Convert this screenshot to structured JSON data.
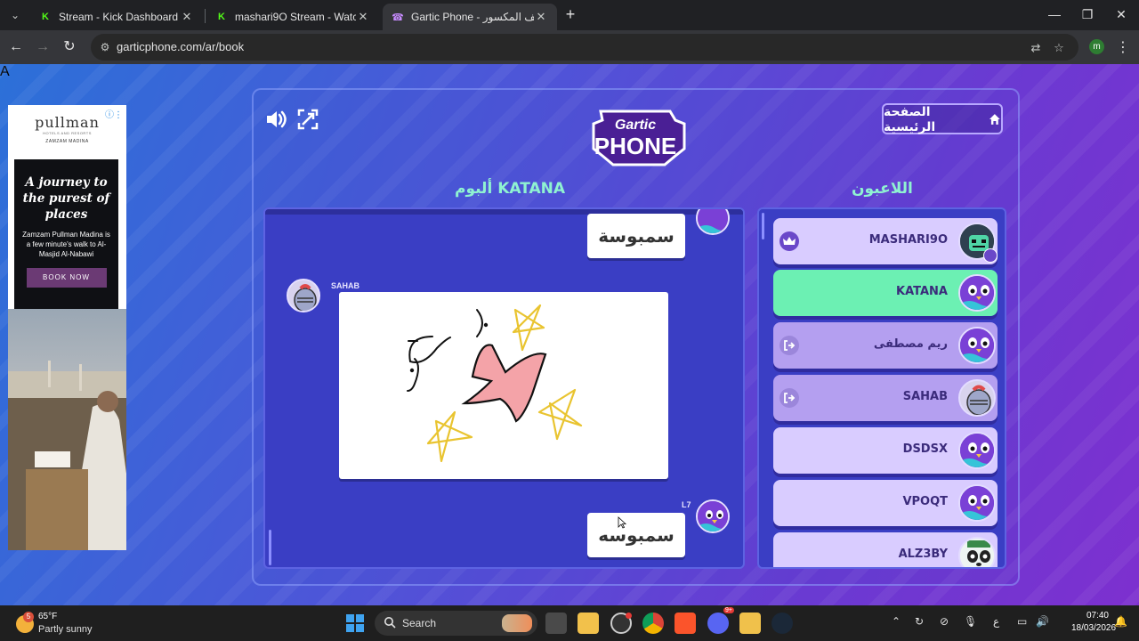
{
  "browser": {
    "tabs": [
      {
        "title": "Stream - Kick Dashboard",
        "favicon": "kick-icon"
      },
      {
        "title": "mashari9O Stream - Watch Live",
        "favicon": "kick-icon"
      },
      {
        "title": "Gartic Phone - الهاتف المكسور",
        "favicon": "gartic-phone-icon"
      }
    ],
    "url": "garticphone.com/ar/book",
    "profile_initial": "m"
  },
  "ad": {
    "brand": "pullman",
    "brand_sub": "HOTELS AND RESORTS",
    "location": "ZAMZAM MADINA",
    "headline": "A journey to the purest of places",
    "body": "Zamzam Pullman Madina is a few minute's walk to Al-Masjid Al-Nabawi",
    "cta": "BOOK NOW",
    "adchoice": "A"
  },
  "game": {
    "home_button": "الصفحة الرئيسية",
    "logo": {
      "line1": "Gartic",
      "line2": "PHONE"
    },
    "album_title": "ألبوم KATANA",
    "players_title": "اللاعبون",
    "album": [
      {
        "type": "text",
        "text": "سمبوسة"
      },
      {
        "type": "drawing",
        "author": "SAHAB"
      },
      {
        "type": "text",
        "text": "سمبوسه",
        "author": "L7"
      }
    ],
    "players": [
      {
        "name": "MASHARI9O",
        "state": "host"
      },
      {
        "name": "KATANA",
        "state": "active"
      },
      {
        "name": "ريم مصطفى",
        "state": "away"
      },
      {
        "name": "SAHAB",
        "state": "away"
      },
      {
        "name": "DSDSX",
        "state": "normal"
      },
      {
        "name": "VPOQT",
        "state": "normal"
      },
      {
        "name": "ALZ3BY",
        "state": "normal"
      }
    ]
  },
  "taskbar": {
    "weather": {
      "temp": "65°F",
      "desc": "Partly sunny",
      "badge": "5"
    },
    "search_label": "Search",
    "discord_badge": "9+",
    "lang": "ع",
    "time": "07:40",
    "date": "18/03/2026"
  },
  "colors": {
    "accent_mint": "#8ff2d1",
    "active_player": "#6cf0b3",
    "panel": "#3a3ec4"
  }
}
